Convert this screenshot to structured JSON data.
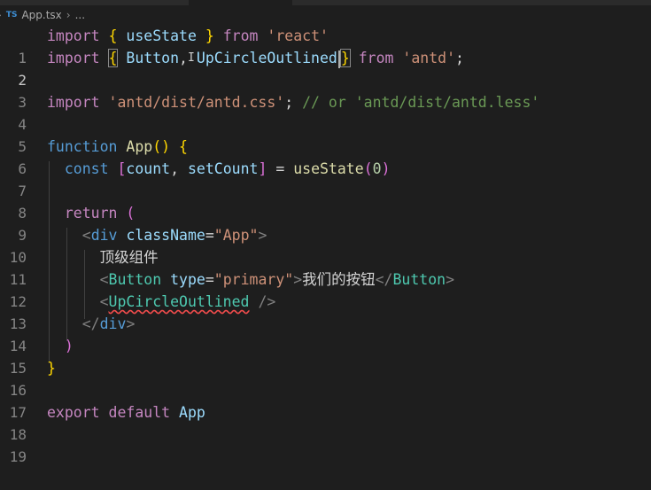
{
  "breadcrumb": {
    "lead": "›",
    "file_icon": "TS",
    "file": "App.tsx",
    "sep": "›",
    "rest": "..."
  },
  "editor": {
    "active_line": 2,
    "lines": [
      {
        "n": "1"
      },
      {
        "n": "2"
      },
      {
        "n": "3"
      },
      {
        "n": "4"
      },
      {
        "n": "5"
      },
      {
        "n": "6"
      },
      {
        "n": "7"
      },
      {
        "n": "8"
      },
      {
        "n": "9"
      },
      {
        "n": "10"
      },
      {
        "n": "11"
      },
      {
        "n": "12"
      },
      {
        "n": "13"
      },
      {
        "n": "14"
      },
      {
        "n": "15"
      },
      {
        "n": "16"
      },
      {
        "n": "17"
      },
      {
        "n": "18"
      },
      {
        "n": "19"
      }
    ],
    "tokens": {
      "import": "import",
      "from": "from",
      "useState": "useState",
      "react": "'react'",
      "Button": "Button",
      "UpCircleOutlined": "UpCircleOutlined",
      "antd": "'antd'",
      "antd_css": "'antd/dist/antd.css'",
      "comment": "// or 'antd/dist/antd.less'",
      "function": "function",
      "App": "App",
      "const": "const",
      "count": "count",
      "setCount": "setCount",
      "zero": "0",
      "return": "return",
      "div": "div",
      "className": "className",
      "App_str": "\"App\"",
      "text_component": "顶级组件",
      "type": "type",
      "primary": "\"primary\"",
      "button_text": "我们的按钮",
      "export": "export",
      "default": "default"
    }
  },
  "colors": {
    "background": "#1e1e1e",
    "keyword": "#c586c0",
    "variable": "#9cdcfe",
    "function": "#dcdcaa",
    "string": "#ce9178",
    "comment": "#6a9955",
    "tag": "#4ec9b0"
  }
}
